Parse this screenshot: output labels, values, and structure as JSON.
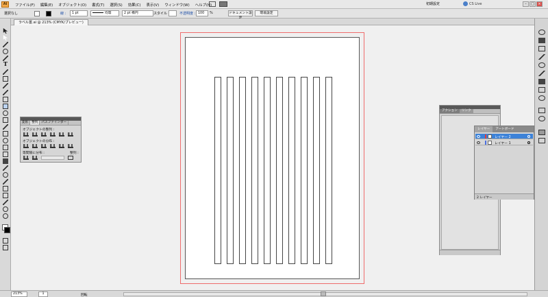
{
  "app": {
    "logo": "Ai"
  },
  "menu": [
    "ファイル(F)",
    "編集(E)",
    "オブジェクト(O)",
    "書式(T)",
    "選択(S)",
    "効果(C)",
    "表示(V)",
    "ウィンドウ(W)",
    "ヘルプ(H)"
  ],
  "workspace": "初期設定",
  "cslive": "CS Live",
  "control": {
    "selection": "選択なし",
    "stroke_label": "線 :",
    "stroke_width": "1 pt",
    "brush": "均等",
    "profile": "2 pt 楕円",
    "style_label": "スタイル :",
    "opacity_label": "不透明度 :",
    "opacity": "100",
    "percent": "%",
    "doc_setup": "ドキュメント設定",
    "preferences": "環境設定"
  },
  "document": {
    "tab": "ラベル置.ai @ 213% (CMYK/プレビュー)"
  },
  "align_panel": {
    "tabs": [
      "変形",
      "整列",
      "パスファインダー"
    ],
    "section_align": "オブジェクトの整列 :",
    "section_distribute": "オブジェクトの分布 :",
    "section_spacing": "等間隔に分布 :",
    "align_to": "整列 :"
  },
  "actions_panel": {
    "tabs": [
      "アクション",
      "リンク"
    ]
  },
  "layers_panel": {
    "tabs": [
      "レイヤー",
      "アートボード"
    ],
    "layers": [
      {
        "name": "レイヤー 2",
        "color": "#e23b3b",
        "selected": true
      },
      {
        "name": "レイヤー 1",
        "color": "#4a6fe0",
        "selected": false
      }
    ],
    "count": "2 レイヤー"
  },
  "status": {
    "zoom": "213%",
    "page": "1",
    "mode": "回転"
  },
  "chart_data": null
}
